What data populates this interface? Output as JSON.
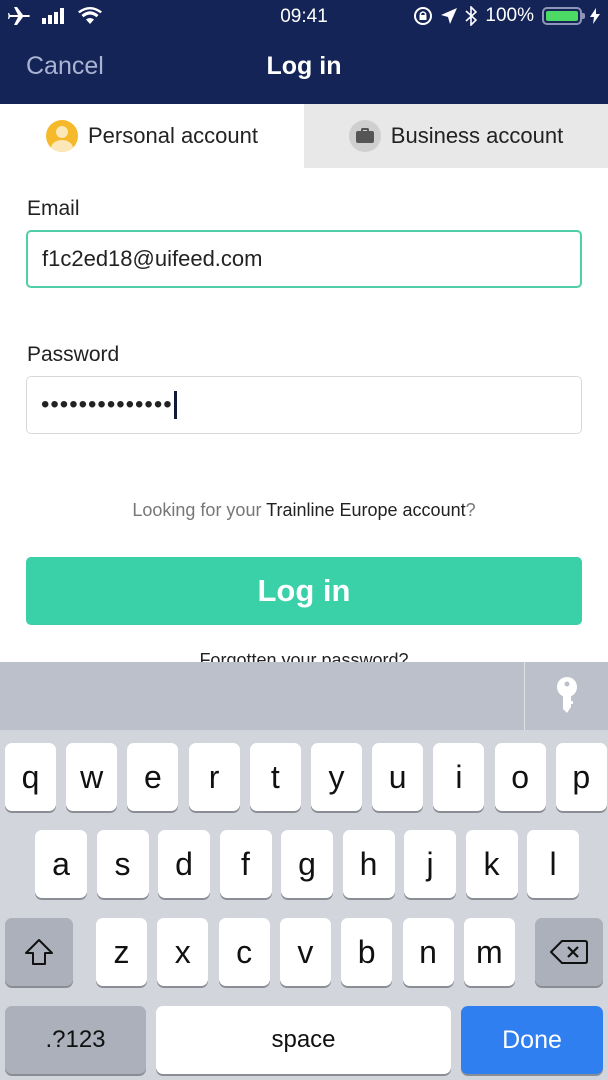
{
  "status_bar": {
    "time": "09:41",
    "battery_percent": "100%",
    "icons": [
      "airplane-icon",
      "signal-icon",
      "wifi-icon",
      "rotation-lock-icon",
      "location-icon",
      "bluetooth-icon",
      "battery-icon",
      "charging-icon"
    ]
  },
  "nav": {
    "cancel_label": "Cancel",
    "title": "Log in"
  },
  "tabs": [
    {
      "label": "Personal account",
      "icon": "person-icon",
      "active": true
    },
    {
      "label": "Business account",
      "icon": "briefcase-icon",
      "active": false
    }
  ],
  "form": {
    "email_label": "Email",
    "email_value": "f1c2ed18@uifeed.com",
    "password_label": "Password",
    "password_masked": "••••••••••••••",
    "hint_prefix": "Looking for your ",
    "hint_link": "Trainline Europe account",
    "hint_suffix": "?",
    "login_button": "Log in",
    "forgot_link": "Forgotten your password?"
  },
  "colors": {
    "nav_bg": "#142456",
    "accent": "#3ad0a8",
    "done_key": "#2f7ff0"
  },
  "keyboard": {
    "row1": [
      "q",
      "w",
      "e",
      "r",
      "t",
      "y",
      "u",
      "i",
      "o",
      "p"
    ],
    "row2": [
      "a",
      "s",
      "d",
      "f",
      "g",
      "h",
      "j",
      "k",
      "l"
    ],
    "row3": [
      "z",
      "x",
      "c",
      "v",
      "b",
      "n",
      "m"
    ],
    "numbers_label": ".?123",
    "space_label": "space",
    "done_label": "Done"
  }
}
